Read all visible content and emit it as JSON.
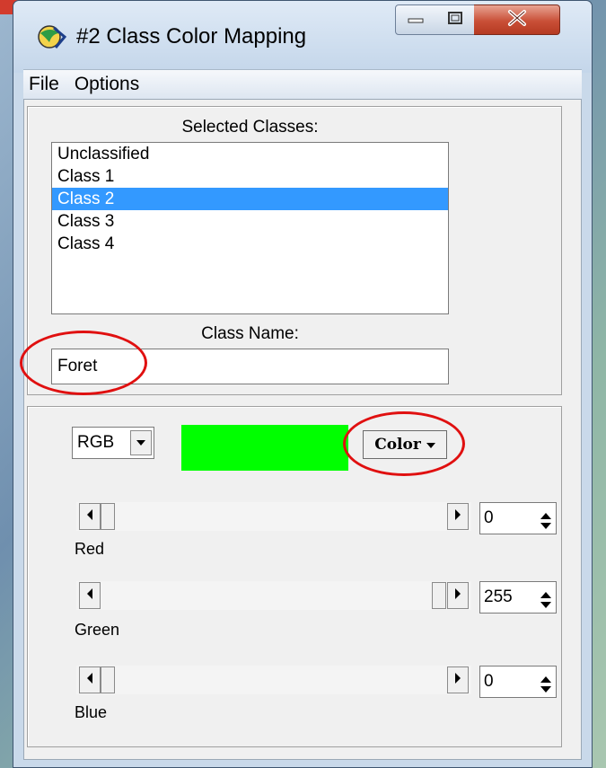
{
  "window": {
    "title": "#2 Class Color Mapping",
    "controls": {
      "minimize": "minimize",
      "maximize": "maximize",
      "close": "close"
    }
  },
  "menu": {
    "items": [
      "File",
      "Options"
    ]
  },
  "selected_classes": {
    "label": "Selected Classes:",
    "items": [
      "Unclassified",
      "Class 1",
      "Class 2",
      "Class 3",
      "Class 4"
    ],
    "selected_index": 2
  },
  "class_name": {
    "label": "Class Name:",
    "value": "Foret"
  },
  "color": {
    "model": "RGB",
    "swatch_color": "#00ff00",
    "button_label": "Color",
    "channels": [
      {
        "name": "Red",
        "value": "0",
        "level": 0
      },
      {
        "name": "Green",
        "value": "255",
        "level": 1
      },
      {
        "name": "Blue",
        "value": "0",
        "level": 0
      }
    ]
  },
  "annotations": {
    "highlight_color": "#e01010"
  }
}
